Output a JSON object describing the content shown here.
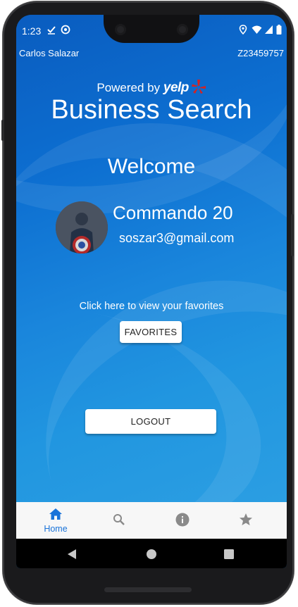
{
  "status_bar": {
    "time": "1:23",
    "left_icons": [
      "check-icon",
      "at-sign-icon"
    ],
    "right_icons": [
      "location-icon",
      "wifi-icon",
      "signal-icon",
      "battery-icon"
    ]
  },
  "header": {
    "user_full_name": "Carlos Salazar",
    "student_id": "Z23459757",
    "powered_by": "Powered by",
    "brand": "yelp",
    "app_title": "Business Search"
  },
  "main": {
    "welcome": "Welcome",
    "username": "Commando 20",
    "email": "soszar3@gmail.com",
    "favorites_prompt": "Click here to view your favorites",
    "favorites_button": "FAVORITES",
    "logout_button": "LOGOUT"
  },
  "tab_bar": {
    "active": "Home",
    "tabs": [
      {
        "label": "Home",
        "icon": "home-icon"
      },
      {
        "label": "",
        "icon": "search-icon"
      },
      {
        "label": "",
        "icon": "info-icon"
      },
      {
        "label": "",
        "icon": "star-icon"
      }
    ]
  },
  "system_nav": [
    "back-icon",
    "home-circle-icon",
    "recents-icon"
  ],
  "colors": {
    "accent": "#1a73d9",
    "background_top": "#0a5cbf",
    "background_bottom": "#2b9ee2",
    "yelp_red": "#d32323"
  }
}
